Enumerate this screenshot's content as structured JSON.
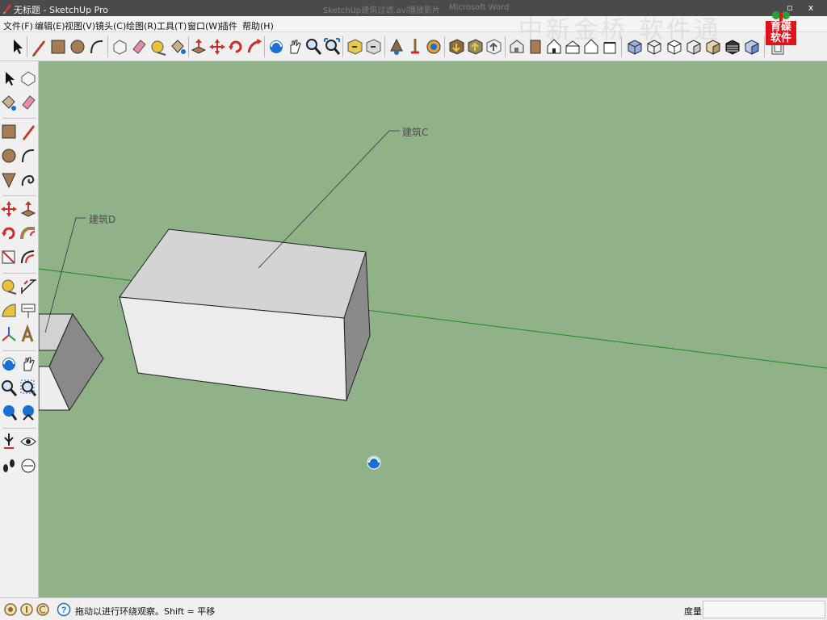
{
  "window": {
    "title": "无标题 - SketchUp Pro",
    "background_title_1": "SketchUp建筑过滤.avi",
    "background_title_2": "播放影片",
    "background_title_3": "Microsoft Word",
    "close_glyph": "x",
    "restore_glyph": "▫"
  },
  "menu": {
    "items": [
      "文件(F)",
      "编辑(E)",
      "视图(V)",
      "镜头(C)",
      "绘图(R)",
      "工具(T)",
      "窗口(W)",
      "插件",
      "帮助(H)"
    ]
  },
  "watermark": {
    "text": "中新金桥 软件通",
    "logo_text_1": "育碟",
    "logo_text_2": "软件"
  },
  "toolbar": {
    "icons": [
      "select-icon",
      "pencil-icon",
      "rectangle-icon",
      "circle-icon",
      "arc-icon",
      "make-component-icon",
      "eraser-icon",
      "tape-measure-icon",
      "paint-bucket-icon",
      "push-pull-icon",
      "move-icon",
      "rotate-icon",
      "follow-me-icon",
      "orbit-icon",
      "pan-icon",
      "zoom-icon",
      "zoom-extents-icon",
      "previous-view-icon",
      "next-view-icon",
      "position-camera-icon",
      "walk-icon",
      "look-around-icon",
      "get-models-icon",
      "share-model-icon",
      "share-component-icon",
      "iso-view-icon",
      "top-view-icon",
      "front-view-icon",
      "right-view-icon",
      "back-view-icon",
      "left-view-icon",
      "xray-icon",
      "wireframe-icon",
      "hidden-line-icon",
      "shaded-icon",
      "shaded-textures-icon",
      "monochrome-icon",
      "section-icon"
    ]
  },
  "sidebar": {
    "icons": [
      "select-icon",
      "make-component-icon",
      "paint-bucket-icon",
      "eraser-icon",
      "rectangle-icon",
      "line-icon",
      "circle-icon",
      "arc-icon",
      "polygon-icon",
      "freehand-icon",
      "move-icon",
      "push-pull-icon",
      "rotate-icon",
      "follow-me-icon",
      "scale-icon",
      "offset-icon",
      "tape-measure-icon",
      "dimension-icon",
      "protractor-icon",
      "text-icon",
      "axes-icon",
      "3d-text-icon",
      "orbit-icon",
      "pan-icon",
      "zoom-icon",
      "zoom-window-icon",
      "zoom-extents-icon",
      "previous-view-icon",
      "position-camera-icon",
      "look-around-icon",
      "walk-icon",
      "section-plane-icon"
    ]
  },
  "viewport": {
    "background": "#8fb288",
    "labels": {
      "building_c": "建筑C",
      "building_d": "建筑D"
    }
  },
  "status": {
    "hint": "拖动以进行环绕观察。Shift = 平移",
    "measure_label": "度量",
    "measure_value": ""
  }
}
